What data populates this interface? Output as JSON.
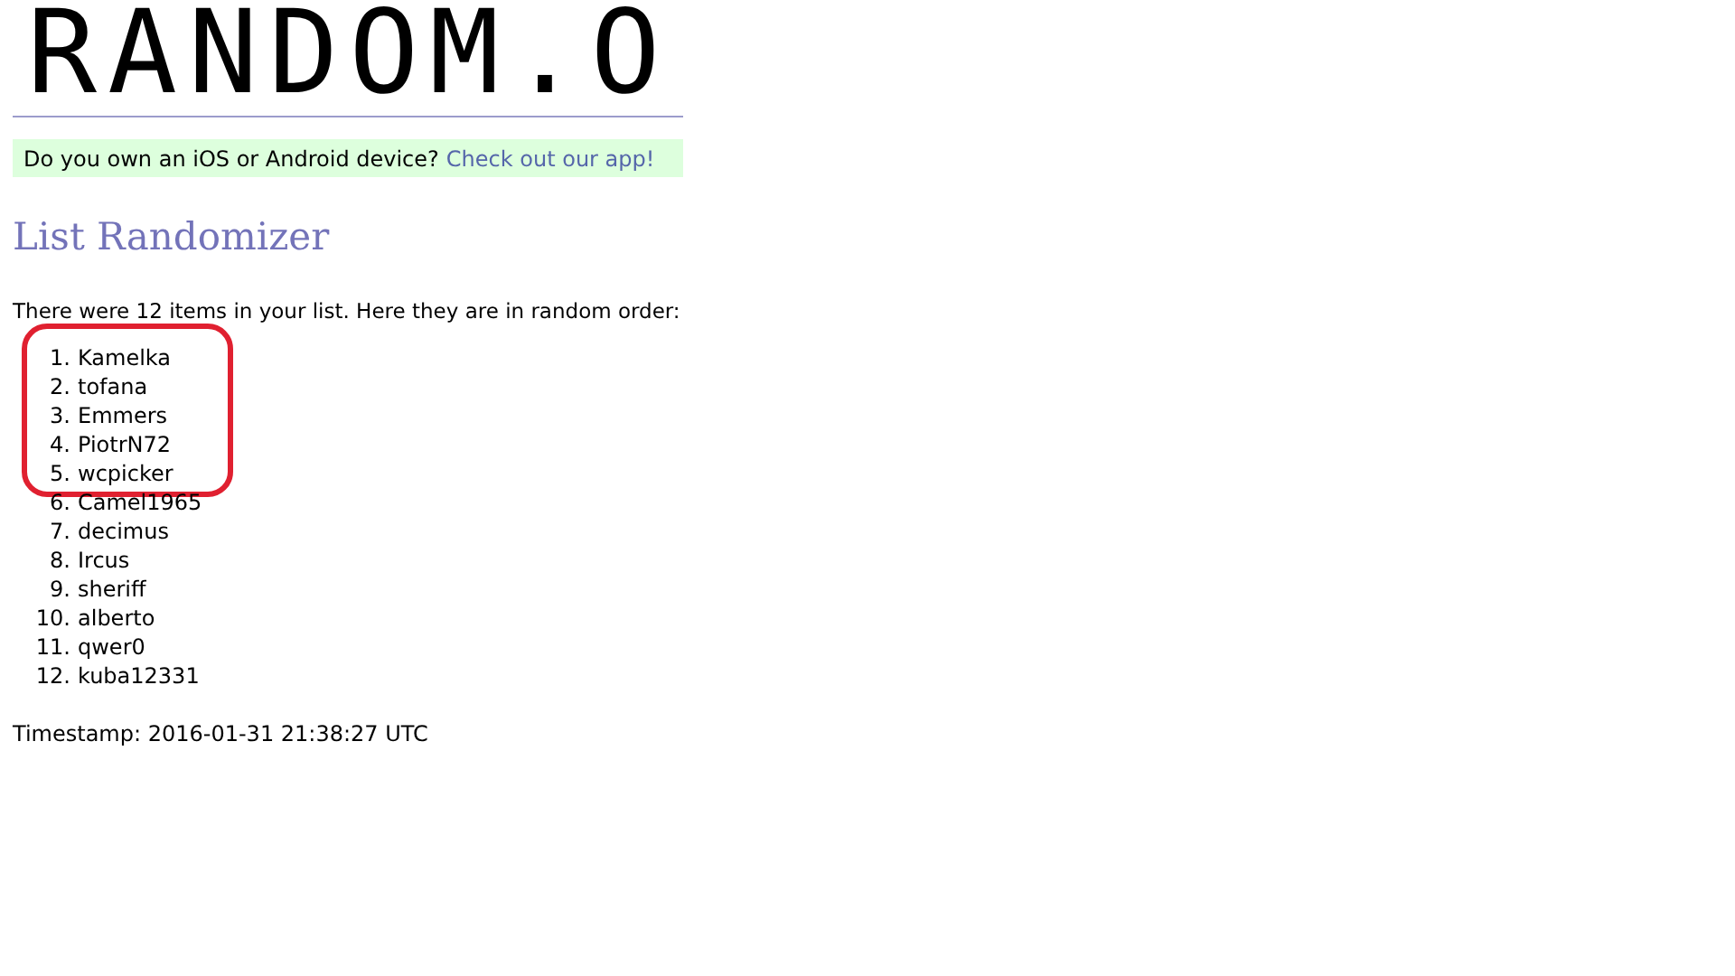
{
  "logo": "RANDOM.O",
  "app_banner": {
    "text": "Do you own an iOS or Android device?",
    "link": "Check out our app!"
  },
  "heading": "List Randomizer",
  "intro": "There were 12 items in your list. Here they are in random order:",
  "items": [
    {
      "number": "1.",
      "name": "Kamelka",
      "circled": true
    },
    {
      "number": "2.",
      "name": "tofana",
      "circled": true
    },
    {
      "number": "3.",
      "name": "Emmers",
      "circled": true
    },
    {
      "number": "4.",
      "name": "PiotrN72",
      "circled": true
    },
    {
      "number": "5.",
      "name": "wcpicker",
      "circled": true
    },
    {
      "number": "6.",
      "name": "Camel1965",
      "circled": false
    },
    {
      "number": "7.",
      "name": "decimus",
      "circled": false
    },
    {
      "number": "8.",
      "name": "Ircus",
      "circled": false
    },
    {
      "number": "9.",
      "name": "sheriff",
      "circled": false
    },
    {
      "number": "10.",
      "name": "alberto",
      "circled": false
    },
    {
      "number": "11.",
      "name": "qwer0",
      "circled": false
    },
    {
      "number": "12.",
      "name": "kuba12331",
      "circled": false
    }
  ],
  "timestamp": "Timestamp: 2016-01-31 21:38:27 UTC"
}
